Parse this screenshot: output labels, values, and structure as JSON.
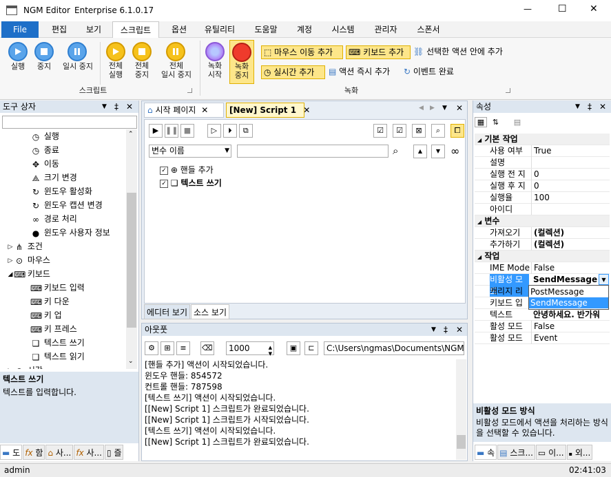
{
  "window": {
    "title": "NGM Editor",
    "edition": "Enterprise 6.1.0.17",
    "minimize": "—",
    "maximize": "☐",
    "close": "✕"
  },
  "menu": {
    "file": "File",
    "items": [
      "편집",
      "보기",
      "스크립트",
      "옵션",
      "유틸리티",
      "도움말",
      "계정",
      "시스템",
      "관리자",
      "스폰서"
    ],
    "active": "스크립트"
  },
  "ribbon": {
    "script_group": "스크립트",
    "record_group": "녹화",
    "run": "실행",
    "stop": "중지",
    "pause": "일시 중지",
    "all_run_1": "전체",
    "all_run_2": "실행",
    "all_stop_1": "전체",
    "all_stop_2": "중지",
    "all_pause_1": "전체",
    "all_pause_2": "일시 중지",
    "rec_start_1": "녹화",
    "rec_start_2": "시작",
    "rec_stop_1": "녹화",
    "rec_stop_2": "중지",
    "add_mouse_move": "마우스 이동 추가",
    "add_keyboard": "키보드 추가",
    "add_to_selected": "선택한 액션 안에 추가",
    "add_realtime": "실시간 추가",
    "instant_add": "액션 즉시 추가",
    "event_done": "이벤트 완료"
  },
  "toolbox": {
    "title": "도구 상자",
    "items": [
      {
        "label": "실행",
        "icon": "clock-icon"
      },
      {
        "label": "종료",
        "icon": "clock-icon"
      },
      {
        "label": "이동",
        "icon": "move-icon"
      },
      {
        "label": "크기 변경",
        "icon": "resize-icon"
      },
      {
        "label": "윈도우 활성화",
        "icon": "refresh-icon"
      },
      {
        "label": "윈도우 캡션 변경",
        "icon": "refresh-icon"
      },
      {
        "label": "경로 처리",
        "icon": "infinity-icon"
      },
      {
        "label": "윈도우 사용자 정보",
        "icon": "user-icon"
      }
    ],
    "groups": [
      {
        "label": "조건"
      },
      {
        "label": "마우스"
      },
      {
        "label": "키보드"
      }
    ],
    "keyboard_items": [
      {
        "label": "키보드 입력"
      },
      {
        "label": "키 다운"
      },
      {
        "label": "키 업"
      },
      {
        "label": "키 프레스"
      },
      {
        "label": "텍스트 쓰기"
      },
      {
        "label": "텍스트 읽기"
      }
    ],
    "cut_item": "시간",
    "desc_title": "텍스트 쓰기",
    "desc_text": "텍스트를 입력합니다.",
    "tabs": [
      "도",
      "함",
      "사...",
      "사...",
      "즐"
    ]
  },
  "editor": {
    "tabs": [
      "시작 페이지",
      "[New] Script 1"
    ],
    "var_select": "변수 이름",
    "actions": [
      {
        "label": "핸들 추가",
        "bold": false
      },
      {
        "label": "텍스트 쓰기",
        "bold": true
      }
    ],
    "bottom_tabs": [
      "에디터 보기",
      "소스 보기"
    ]
  },
  "output": {
    "title": "아웃풋",
    "count": "1000",
    "path": "C:\\Users\\ngmas\\Documents\\NGM6\\",
    "lines": [
      "[핸들 추가] 액션이 시작되었습니다.",
      "윈도우 핸들: 854572",
      "컨트롤 핸들: 787598",
      "[텍스트 쓰기] 액션이 시작되었습니다.",
      "[[New] Script 1] 스크립트가 완료되었습니다.",
      "[[New] Script 1] 스크립트가 시작되었습니다.",
      "[텍스트 쓰기] 액션이 시작되었습니다.",
      "[[New] Script 1] 스크립트가 완료되었습니다."
    ]
  },
  "properties": {
    "title": "속성",
    "sections": {
      "basic": "기본 작업",
      "variable": "변수",
      "work": "작업"
    },
    "basic_rows": [
      {
        "name": "사용 여부",
        "value": "True"
      },
      {
        "name": "설명",
        "value": ""
      },
      {
        "name": "실행 전 지",
        "value": "0"
      },
      {
        "name": "실행 후 지",
        "value": "0"
      },
      {
        "name": "실행율",
        "value": "100"
      },
      {
        "name": "아이디",
        "value": ""
      }
    ],
    "variable_rows": [
      {
        "name": "가져오기",
        "value": "(컬렉션)"
      },
      {
        "name": "추가하기",
        "value": "(컬렉션)"
      }
    ],
    "work_rows": [
      {
        "name": "IME Mode",
        "value": "False"
      },
      {
        "name": "비활성 모드",
        "value": "SendMessage"
      },
      {
        "name": "캐리지 리",
        "value": ""
      },
      {
        "name": "키보드 입",
        "value": ""
      },
      {
        "name": "텍스트",
        "value": "안녕하세요. 반가워"
      },
      {
        "name": "활성 모드",
        "value": "False"
      },
      {
        "name": "활성 모드",
        "value": "Event"
      }
    ],
    "dropdown_options": [
      "PostMessage",
      "SendMessage"
    ],
    "desc_title": "비활성 모드 방식",
    "desc_text": "비활성 모드에서 액션을 처리하는 방식을 선택할 수 있습니다.",
    "tabs": [
      "속",
      "스크...",
      "이...",
      "외..."
    ]
  },
  "status": {
    "user": "admin",
    "time": "02:41:03"
  },
  "colors": {
    "accent": "#1e6fc8",
    "selection": "#3399ff",
    "tab_active": "#fff7cc"
  }
}
